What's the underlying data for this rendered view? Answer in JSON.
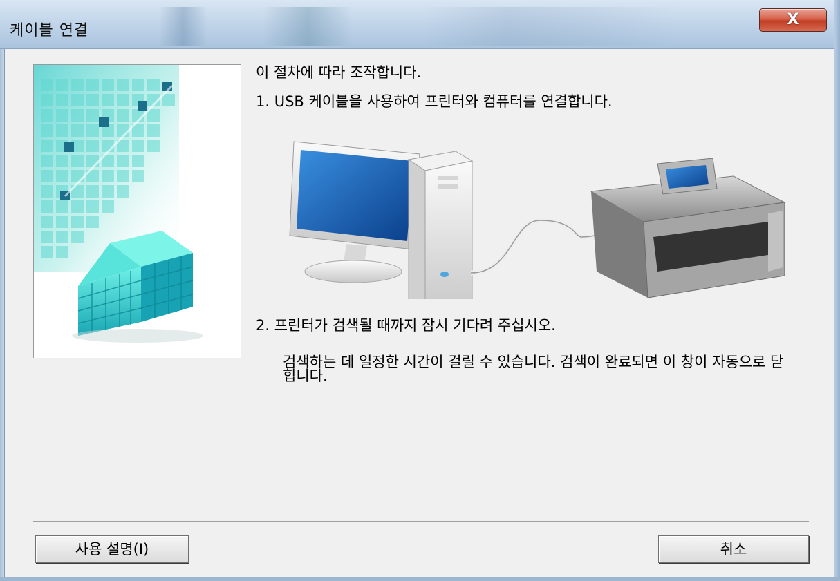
{
  "window": {
    "title": "케이블 연결",
    "close_label": "X"
  },
  "content": {
    "intro": "이 절차에 따라 조작합니다.",
    "step1": "1.  USB 케이블을 사용하여 프린터와 컴퓨터를 연결합니다.",
    "step2": "2.  프린터가 검색될 때까지 잠시 기다려 주십시오.",
    "note": "검색하는 데 일정한 시간이 걸릴 수 있습니다. 검색이 완료되면 이 창이 자동으로 닫힙니다."
  },
  "buttons": {
    "help": "사용 설명(I)",
    "cancel": "취소"
  },
  "icons": {
    "side": "cube-graphic",
    "diagram": "computer-usb-printer-illustration"
  },
  "colors": {
    "accent": "#2cc7c4",
    "close": "#c13e24",
    "background": "#f0f0f0"
  }
}
